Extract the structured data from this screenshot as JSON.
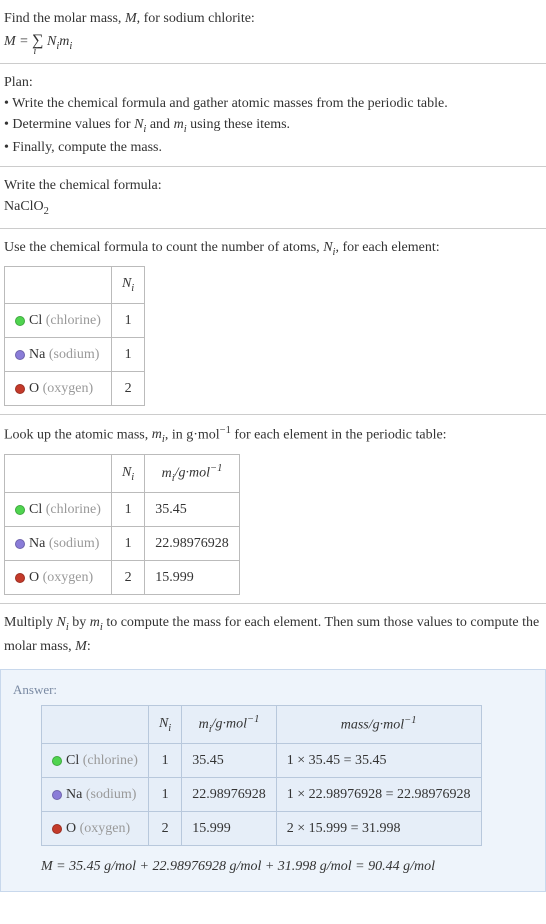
{
  "intro": {
    "line1": "Find the molar mass, M, for sodium chlorite:",
    "formula_text": "M = ∑ Nᵢmᵢ",
    "formula_sub": "i"
  },
  "plan": {
    "title": "Plan:",
    "item1": "• Write the chemical formula and gather atomic masses from the periodic table.",
    "item2_prefix": "• Determine values for ",
    "item2_n": "Nᵢ",
    "item2_and": " and ",
    "item2_m": "mᵢ",
    "item2_suffix": " using these items.",
    "item3": "• Finally, compute the mass."
  },
  "chem_formula": {
    "label": "Write the chemical formula:",
    "value": "NaClO",
    "sub": "2"
  },
  "count_intro": {
    "prefix": "Use the chemical formula to count the number of atoms, ",
    "ni": "Nᵢ",
    "suffix": ", for each element:"
  },
  "table1": {
    "header_ni": "Nᵢ",
    "rows": [
      {
        "sym": "Cl",
        "name": "(chlorine)",
        "dot": "dot-cl",
        "ni": "1"
      },
      {
        "sym": "Na",
        "name": "(sodium)",
        "dot": "dot-na",
        "ni": "1"
      },
      {
        "sym": "O",
        "name": "(oxygen)",
        "dot": "dot-o",
        "ni": "2"
      }
    ]
  },
  "lookup_intro": {
    "prefix": "Look up the atomic mass, ",
    "mi": "mᵢ",
    "mid": ", in g·mol",
    "exp": "−1",
    "suffix": " for each element in the periodic table:"
  },
  "table2": {
    "header_ni": "Nᵢ",
    "header_mi_prefix": "mᵢ/g·mol",
    "header_mi_exp": "−1",
    "rows": [
      {
        "sym": "Cl",
        "name": "(chlorine)",
        "dot": "dot-cl",
        "ni": "1",
        "mi": "35.45"
      },
      {
        "sym": "Na",
        "name": "(sodium)",
        "dot": "dot-na",
        "ni": "1",
        "mi": "22.98976928"
      },
      {
        "sym": "O",
        "name": "(oxygen)",
        "dot": "dot-o",
        "ni": "2",
        "mi": "15.999"
      }
    ]
  },
  "multiply_intro": {
    "prefix": "Multiply ",
    "ni": "Nᵢ",
    "by": " by ",
    "mi": "mᵢ",
    "mid": " to compute the mass for each element. Then sum those values to compute the molar mass, ",
    "M": "M",
    "suffix": ":"
  },
  "answer": {
    "label": "Answer:",
    "header_ni": "Nᵢ",
    "header_mi_prefix": "mᵢ/g·mol",
    "header_mi_exp": "−1",
    "header_mass_prefix": "mass/g·mol",
    "header_mass_exp": "−1",
    "rows": [
      {
        "sym": "Cl",
        "name": "(chlorine)",
        "dot": "dot-cl",
        "ni": "1",
        "mi": "35.45",
        "mass": "1 × 35.45 = 35.45"
      },
      {
        "sym": "Na",
        "name": "(sodium)",
        "dot": "dot-na",
        "ni": "1",
        "mi": "22.98976928",
        "mass": "1 × 22.98976928 = 22.98976928"
      },
      {
        "sym": "O",
        "name": "(oxygen)",
        "dot": "dot-o",
        "ni": "2",
        "mi": "15.999",
        "mass": "2 × 15.999 = 31.998"
      }
    ],
    "final": "M = 35.45 g/mol + 22.98976928 g/mol + 31.998 g/mol = 90.44 g/mol"
  }
}
